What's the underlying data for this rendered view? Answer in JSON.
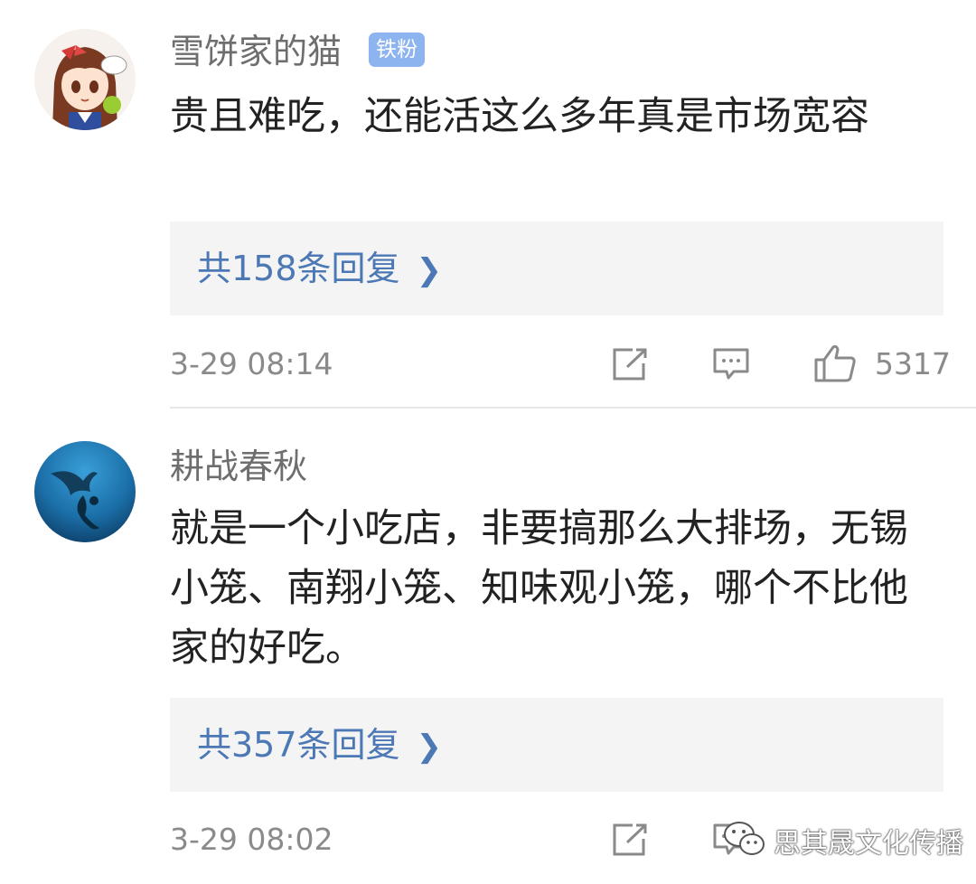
{
  "comments": [
    {
      "username": "雪饼家的猫",
      "badge": "铁粉",
      "text": "贵且难吃，还能活这么多年真是市场宽容",
      "replies_label": "共158条回复",
      "time": "3-29 08:14",
      "likes": "5317",
      "avatar": "anime-girl-avatar"
    },
    {
      "username": "耕战春秋",
      "text": "就是一个小吃店，非要搞那么大排场，无锡小笼、南翔小笼、知味观小笼，哪个不比他家的好吃。",
      "replies_label": "共357条回复",
      "time": "3-29 08:02",
      "avatar": "manta-ray-diver-avatar"
    }
  ],
  "icons": {
    "share": "share-icon",
    "reply": "comment-icon",
    "like": "thumbs-up-icon",
    "chevron": "chevron-right-icon"
  },
  "watermark": {
    "text": "思其晟文化传播",
    "icon": "wechat-icon"
  },
  "colors": {
    "link": "#4c78b5",
    "badge": "#8eb4f0",
    "muted": "#8a8a8a",
    "reply_bg": "#f4f4f4"
  }
}
